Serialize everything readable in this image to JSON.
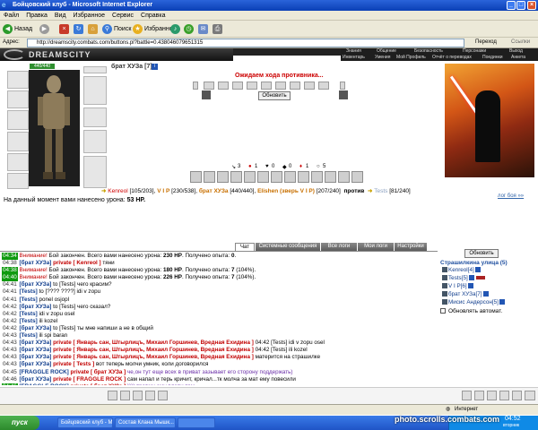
{
  "window": {
    "title": "Бойцовский клуб - Microsoft Internet Explorer"
  },
  "menu": [
    "Файл",
    "Правка",
    "Вид",
    "Избранное",
    "Сервис",
    "Справка"
  ],
  "toolbar": {
    "back": "Назад",
    "search": "Поиск",
    "favorites": "Избранное"
  },
  "address": {
    "label": "Адрес:",
    "url": "http://dreamscity.combats.com/buttons.pl?battle=0.438046079651315",
    "go": "Переход",
    "links": "Ссылки"
  },
  "site": {
    "logo": "DREAMSCITY"
  },
  "topnav": {
    "row1": [
      "Знания",
      "Общение",
      "Безопасность",
      "Персонажи",
      "Выход"
    ],
    "row2": [
      "Инвентарь",
      "Умения",
      "Мой Профиль",
      "Отчёт о переводах",
      "Поединки",
      "Анкета"
    ]
  },
  "character": {
    "hp": "440/440"
  },
  "enemy": {
    "name": "брат ХУЗа [7]"
  },
  "battle": {
    "waiting": "Ожидаем хода противника...",
    "refresh_button": "Обновить",
    "stats": [
      "3",
      "1",
      "0",
      "0",
      "1",
      "5"
    ],
    "fighters": {
      "left": [
        {
          "name": "Kenreol",
          "hp": "[105/203]"
        },
        {
          "name": "V I P",
          "hp": "[230/538]"
        },
        {
          "name": "брат ХУЗа",
          "hp": "[440/440]"
        },
        {
          "name": "Elishen (зверь V I P)",
          "hp": "[207/240]"
        }
      ],
      "versus": "против",
      "right": [
        {
          "name": "Tests",
          "hp": "[81/240]"
        }
      ]
    },
    "damage_text": "На данный момент вами нанесено урона:",
    "damage_value": "53 HP.",
    "battle_log_link": "лог боя »»"
  },
  "chat_tabs": [
    "Чат",
    "Системные сообщения",
    "Все логи",
    "Мои логи",
    "Настройки"
  ],
  "chat": [
    {
      "time": "04:34",
      "green": true,
      "parts": [
        {
          "c": "warn",
          "t": "Внимание! "
        },
        {
          "c": "",
          "t": "Бой закончен. Всего вами нанесено урона: "
        },
        {
          "c": "b",
          "t": "230 HP"
        },
        {
          "c": "",
          "t": ". Получено опыта: "
        },
        {
          "c": "b",
          "t": "0"
        },
        {
          "c": "",
          "t": "."
        }
      ]
    },
    {
      "time": "04:38",
      "green": false,
      "parts": [
        {
          "c": "nick",
          "t": "[брат ХУЗа] "
        },
        {
          "c": "priv",
          "t": "private [ Kenreol ] "
        },
        {
          "c": "",
          "t": "тяни"
        }
      ]
    },
    {
      "time": "04:38",
      "green": true,
      "parts": [
        {
          "c": "warn",
          "t": "Внимание! "
        },
        {
          "c": "",
          "t": "Бой закончен. Всего вами нанесено урона: "
        },
        {
          "c": "b",
          "t": "180 HP"
        },
        {
          "c": "",
          "t": ". Получено опыта: "
        },
        {
          "c": "b",
          "t": "7"
        },
        {
          "c": "",
          "t": " (104%)."
        }
      ]
    },
    {
      "time": "04:40",
      "green": true,
      "parts": [
        {
          "c": "warn",
          "t": "Внимание! "
        },
        {
          "c": "",
          "t": "Бой закончен. Всего вами нанесено урона: "
        },
        {
          "c": "b",
          "t": "226 HP"
        },
        {
          "c": "",
          "t": ". Получено опыта: "
        },
        {
          "c": "b",
          "t": "7"
        },
        {
          "c": "",
          "t": " (104%)."
        }
      ]
    },
    {
      "time": "04:41",
      "green": false,
      "parts": [
        {
          "c": "nick",
          "t": "[брат ХУЗа] "
        },
        {
          "c": "",
          "t": "to [Tests] чего красим?"
        }
      ]
    },
    {
      "time": "04:41",
      "green": false,
      "parts": [
        {
          "c": "nick",
          "t": "[Tests] "
        },
        {
          "c": "",
          "t": "to [???? ????] idi v zopu"
        }
      ]
    },
    {
      "time": "04:41",
      "green": false,
      "parts": [
        {
          "c": "nick",
          "t": "[Tests] "
        },
        {
          "c": "",
          "t": "ponel osjopl"
        }
      ]
    },
    {
      "time": "04:42",
      "green": false,
      "parts": [
        {
          "c": "nick",
          "t": "[брат ХУЗа] "
        },
        {
          "c": "",
          "t": "to [Tests] чего сказал?"
        }
      ]
    },
    {
      "time": "04:42",
      "green": false,
      "parts": [
        {
          "c": "nick",
          "t": "[Tests] "
        },
        {
          "c": "",
          "t": "idi v zopu osel"
        }
      ]
    },
    {
      "time": "04:42",
      "green": false,
      "parts": [
        {
          "c": "nick",
          "t": "[Tests] "
        },
        {
          "c": "",
          "t": "ili kozel"
        }
      ]
    },
    {
      "time": "04:42",
      "green": false,
      "parts": [
        {
          "c": "nick",
          "t": "[брат ХУЗа] "
        },
        {
          "c": "",
          "t": "to [Tests] ты мне напиши а не в общий"
        }
      ]
    },
    {
      "time": "04:43",
      "green": false,
      "parts": [
        {
          "c": "nick",
          "t": "[Tests] "
        },
        {
          "c": "",
          "t": "ili spi baran"
        }
      ]
    },
    {
      "time": "04:43",
      "green": false,
      "parts": [
        {
          "c": "nick",
          "t": "[брат ХУЗа] "
        },
        {
          "c": "priv",
          "t": "private [ Январь сан, Штырлицъ, Михаил Горшинев, Вредная Ехидина ] "
        },
        {
          "c": "",
          "t": "04:42 [Tests] idi v zopu osel"
        }
      ]
    },
    {
      "time": "04:43",
      "green": false,
      "parts": [
        {
          "c": "nick",
          "t": "[брат ХУЗа] "
        },
        {
          "c": "priv",
          "t": "private [ Январь сан, Штырлицъ, Михаил Горшинев, Вредная Ехидина ] "
        },
        {
          "c": "",
          "t": "04:42 [Tests] ili kozel"
        }
      ]
    },
    {
      "time": "04:43",
      "green": false,
      "parts": [
        {
          "c": "nick",
          "t": "[брат ХУЗа] "
        },
        {
          "c": "priv",
          "t": "private [ Январь сан, Штырлицъ, Михаил Горшинев, Вредная Ехидина ] "
        },
        {
          "c": "",
          "t": "матерится на страшилке"
        }
      ]
    },
    {
      "time": "04:43",
      "green": false,
      "parts": [
        {
          "c": "nick",
          "t": "[брат ХУЗа] "
        },
        {
          "c": "priv",
          "t": "private [ Tests ] "
        },
        {
          "c": "",
          "t": "вот теперь молчи умник, коли договорился"
        }
      ]
    },
    {
      "time": "04:45",
      "green": false,
      "parts": [
        {
          "c": "nick",
          "t": "[FRAGGLE ROCK] "
        },
        {
          "c": "priv",
          "t": "private [ брат ХУЗа ] "
        },
        {
          "c": "priv2",
          "t": "че,он тут еще всех в приват зазывает его сторону поддержать)"
        }
      ]
    },
    {
      "time": "04:46",
      "green": false,
      "parts": [
        {
          "c": "nick",
          "t": "[брат ХУЗа] "
        },
        {
          "c": "priv",
          "t": "private [ FRAGGLE ROCK ] "
        },
        {
          "c": "",
          "t": "сам напал и терь кричит, кричал...тк молча за мат ему повесили"
        }
      ]
    },
    {
      "time": "04:46",
      "green": true,
      "parts": [
        {
          "c": "nick",
          "t": "[FRAGGLE ROCK] "
        },
        {
          "c": "priv",
          "t": "private [ брат ХУЗа ] "
        },
        {
          "c": "priv2",
          "t": ")))) травму ему влепи там"
        }
      ]
    },
    {
      "time": "04:47",
      "green": false,
      "parts": [
        {
          "c": "nick",
          "t": "[брат ХУЗа] "
        },
        {
          "c": "priv",
          "t": "private [ FRAGGLE ROCK ] "
        },
        {
          "c": "",
          "t": "врятли, я ж не критовик ="
        }
      ]
    }
  ],
  "users": {
    "refresh": "Обновить",
    "location": "Страшилкина улица (5)",
    "list": [
      {
        "name": "Kenreol",
        "level": "[4]"
      },
      {
        "name": "Tests",
        "level": "[5]"
      },
      {
        "name": "V I P",
        "level": "[6]"
      },
      {
        "name": "брат ХУЗа",
        "level": "[7]"
      },
      {
        "name": "Мисис Андерсон",
        "level": "[5]"
      }
    ],
    "auto_refresh": "Обновлять автомат."
  },
  "statusbar": {
    "zone": "Интернет"
  },
  "taskbar": {
    "start": "пуск",
    "tasks": [
      "Бойцовский клуб - М...",
      "Состав Клана Мышк...",
      ""
    ],
    "clock": "04:52",
    "clock_day": "вторник"
  },
  "watermark": "photo.scrolls.combats.com",
  "colors": {
    "xp_blue": "#0a3fb5",
    "chat_green": "#0f9a0f",
    "private_red": "#c20000"
  }
}
